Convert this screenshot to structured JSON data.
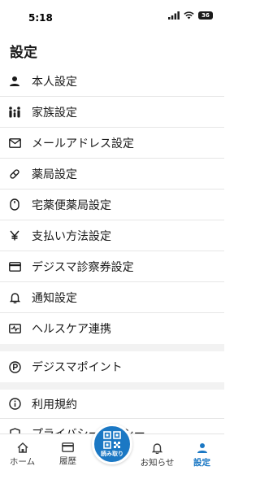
{
  "status_bar": {
    "time": "5:18",
    "battery": "36"
  },
  "page": {
    "title": "設定"
  },
  "menu": {
    "items": [
      {
        "label": "本人設定",
        "icon": "person-icon"
      },
      {
        "label": "家族設定",
        "icon": "family-icon"
      },
      {
        "label": "メールアドレス設定",
        "icon": "mail-icon"
      },
      {
        "label": "薬局設定",
        "icon": "pill-icon"
      },
      {
        "label": "宅薬便薬局設定",
        "icon": "mouse-icon"
      },
      {
        "label": "支払い方法設定",
        "icon": "yen-icon"
      },
      {
        "label": "デジスマ診察券設定",
        "icon": "card-icon"
      },
      {
        "label": "通知設定",
        "icon": "bell-icon"
      },
      {
        "label": "ヘルスケア連携",
        "icon": "health-icon"
      }
    ],
    "points": {
      "label": "デジスマポイント",
      "icon": "point-icon"
    },
    "terms": [
      {
        "label": "利用規約",
        "icon": "info-icon"
      },
      {
        "label": "プライバシーポリシー",
        "icon": "shield-icon"
      }
    ]
  },
  "tab_bar": {
    "tabs": [
      {
        "label": "ホーム",
        "icon": "home-icon"
      },
      {
        "label": "履歴",
        "icon": "history-icon"
      },
      {
        "label": "お知らせ",
        "icon": "bell-icon"
      },
      {
        "label": "設定",
        "icon": "person-icon",
        "active": true
      }
    ],
    "scan": {
      "label": "読み取り",
      "icon": "qr-icon"
    }
  },
  "colors": {
    "accent": "#1b78c4",
    "text": "#1a1a1a",
    "divider": "#e6e6e6"
  }
}
